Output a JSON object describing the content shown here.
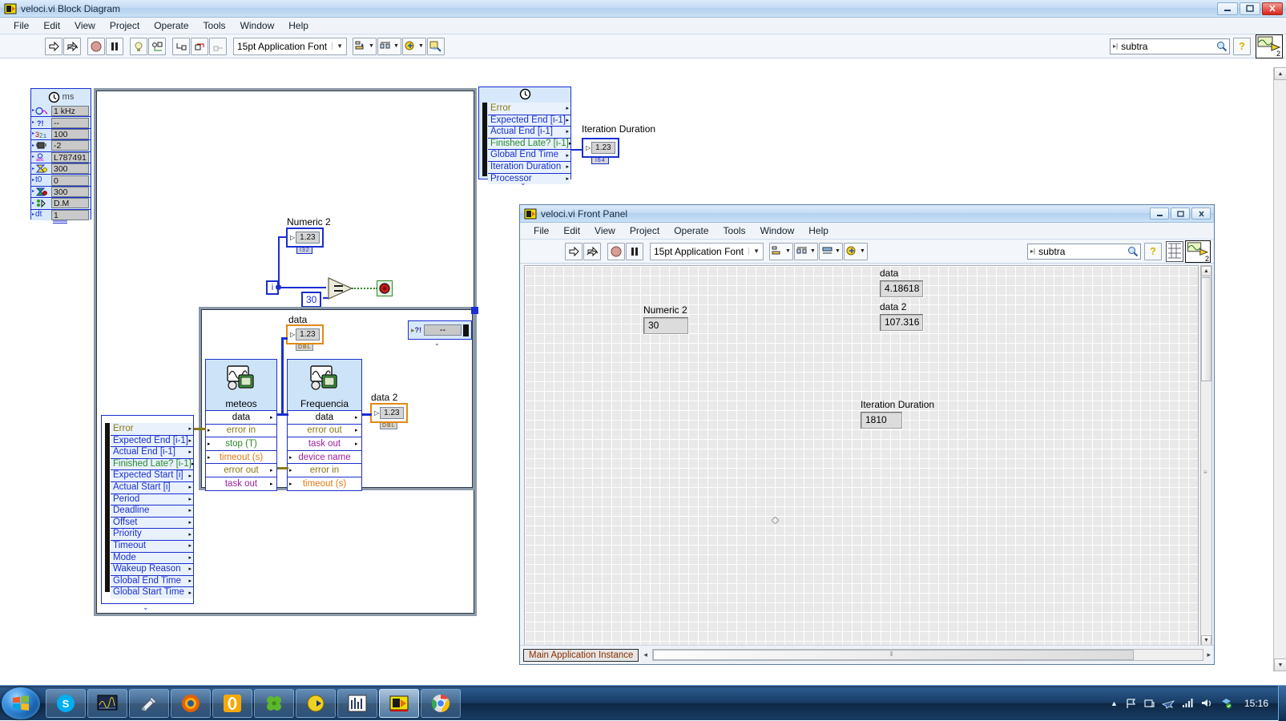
{
  "block_diagram": {
    "window_title": "veloci.vi Block Diagram",
    "app_icon": "labview-vi-icon",
    "window_buttons": [
      {
        "name": "minimize-button",
        "glyph": "—"
      },
      {
        "name": "maximize-button",
        "glyph": "❐"
      },
      {
        "name": "close-button",
        "glyph": "✕"
      }
    ],
    "menu": [
      "File",
      "Edit",
      "View",
      "Project",
      "Operate",
      "Tools",
      "Window",
      "Help"
    ],
    "toolbar": {
      "run_label": "run-arrow-icon",
      "run_continuous_label": "run-continuous-icon",
      "abort_label": "abort-execution-icon",
      "pause_label": "pause-icon",
      "highlight_label": "highlight-execution-icon",
      "step_into_label": "step-into-icon",
      "step_over_label": "step-over-icon",
      "step_out_label": "step-out-icon",
      "font": "15pt Application Font",
      "align_label": "align-objects-icon",
      "distribute_label": "distribute-objects-icon",
      "reorder_label": "reorder-icon",
      "cleanup_label": "clean-up-diagram-icon"
    },
    "search": {
      "value": "subtra",
      "placeholder": "",
      "icon": "search-magnifier-icon"
    },
    "help_button": "context-help-icon",
    "palette_badge": "2",
    "timing_node_left": {
      "title_units": "ms",
      "rows": [
        {
          "icon": "source-clock-icon",
          "value": "1 kHz"
        },
        {
          "icon": "error-in-icon",
          "value": "--"
        },
        {
          "icon": "priority-icon",
          "value": "100"
        },
        {
          "icon": "processor-icon",
          "value": "-2"
        },
        {
          "icon": "name-string-icon",
          "value": "L787491"
        },
        {
          "icon": "period-icon",
          "value": "300"
        },
        {
          "icon": "t0-icon",
          "value": "0",
          "label": "t0"
        },
        {
          "icon": "deadline-icon",
          "value": "300"
        },
        {
          "icon": "mode-icon",
          "value": "D.M"
        },
        {
          "icon": "dt-icon",
          "value": "1",
          "label": "dt"
        }
      ]
    },
    "timing_node_right": {
      "title_icon": "clock-icon",
      "rows": [
        "Error",
        "Expected End [i-1]",
        "Actual End [i-1]",
        "Finished Late? [i-1]",
        "Global End Time",
        "Iteration Duration",
        "Processor"
      ]
    },
    "iteration_duration_label": "Iteration Duration",
    "iteration_duration_ind": {
      "value": "1.23",
      "type": "I64"
    },
    "numeric2_label": "Numeric 2",
    "numeric2_ctrl": {
      "value": "1.23",
      "type": "I32"
    },
    "iteration_terminal": "i",
    "constant_30": "30",
    "compare_op": "=",
    "stop_button": "stop-sign-icon",
    "data_label": "data",
    "data_ind": {
      "value": "1.23",
      "type": "DBL"
    },
    "data2_label": "data 2",
    "data2_ind": {
      "value": "1.23",
      "type": "DBL"
    },
    "inner_timing_node": {
      "icon": "error-in-icon",
      "value": "--"
    },
    "subvi_meteos": {
      "name": "meteos",
      "icon": "waveform-daq-icon",
      "terminals": [
        "data",
        "error in",
        "stop (T)",
        "timeout (s)",
        "error out",
        "task out"
      ]
    },
    "subvi_frequencia": {
      "name": "Frequencia",
      "icon": "waveform-daq-icon",
      "terminals": [
        "data",
        "error out",
        "task out",
        "device name",
        "error in",
        "timeout (s)"
      ]
    },
    "cluster_bottom": {
      "rows": [
        "Error",
        "Expected End [i-1]",
        "Actual End [i-1]",
        "Finished Late? [i-1]",
        "Expected Start [i]",
        "Actual Start [i]",
        "Period",
        "Deadline",
        "Offset",
        "Priority",
        "Timeout",
        "Mode",
        "Wakeup Reason",
        "Global End Time",
        "Global Start Time"
      ]
    }
  },
  "front_panel": {
    "window_title": "veloci.vi Front Panel",
    "app_icon": "labview-vi-icon",
    "window_buttons": [
      {
        "name": "minimize-button",
        "glyph": "—"
      },
      {
        "name": "maximize-button",
        "glyph": "❐"
      },
      {
        "name": "close-button",
        "glyph": "✕"
      }
    ],
    "menu": [
      "File",
      "Edit",
      "View",
      "Project",
      "Operate",
      "Tools",
      "Window",
      "Help"
    ],
    "toolbar": {
      "run_label": "run-arrow-icon",
      "run_continuous_label": "run-continuous-icon",
      "abort_label": "abort-execution-icon",
      "pause_label": "pause-icon",
      "font": "15pt Application Font",
      "align_label": "align-objects-icon",
      "distribute_label": "distribute-objects-icon",
      "resize_label": "resize-objects-icon",
      "reorder_label": "reorder-icon"
    },
    "search": {
      "value": "subtra",
      "placeholder": "",
      "icon": "search-magnifier-icon"
    },
    "help_button": "context-help-icon",
    "palette_badge": "2",
    "controls": [
      {
        "name": "numeric2",
        "label": "Numeric 2",
        "value": "30"
      },
      {
        "name": "data",
        "label": "data",
        "value": "4.18618"
      },
      {
        "name": "data2",
        "label": "data 2",
        "value": "107.316"
      },
      {
        "name": "iteration-duration",
        "label": "Iteration Duration",
        "value": "1810"
      }
    ],
    "status_context": "Main Application Instance"
  },
  "taskbar": {
    "start_button": "windows-start-orb",
    "items": [
      {
        "name": "taskbar-item-skype",
        "icon": "skype-icon"
      },
      {
        "name": "taskbar-item-labview-project",
        "icon": "labview-icon"
      },
      {
        "name": "taskbar-item-winrar",
        "icon": "file-tool-icon"
      },
      {
        "name": "taskbar-item-firefox",
        "icon": "firefox-icon"
      },
      {
        "name": "taskbar-item-opera",
        "icon": "opera-icon"
      },
      {
        "name": "taskbar-item-clover",
        "icon": "clover-icon"
      },
      {
        "name": "taskbar-item-labview-vi",
        "icon": "labview-vi-icon"
      },
      {
        "name": "taskbar-item-measurement",
        "icon": "measurement-icon"
      },
      {
        "name": "taskbar-item-veloci-vi",
        "icon": "labview-vi-icon"
      },
      {
        "name": "taskbar-item-chrome",
        "icon": "chrome-icon"
      }
    ],
    "tray": [
      {
        "name": "tray-expand-icon",
        "glyph": "▲"
      },
      {
        "name": "tray-flag-action-center-icon",
        "glyph": "⚑"
      },
      {
        "name": "tray-device-icon",
        "glyph": "🖧"
      },
      {
        "name": "tray-network-plane-icon",
        "glyph": "✈"
      },
      {
        "name": "tray-signal-icon",
        "glyph": "▂▄▆"
      },
      {
        "name": "tray-volume-icon",
        "glyph": "🔊"
      },
      {
        "name": "tray-dropbox-icon",
        "glyph": "◈"
      }
    ],
    "clock": "15:16"
  },
  "colors": {
    "wire_blue": "#1a2fd0",
    "cluster_bg": "#e8f1fc",
    "cluster_header": "#d7e8fb",
    "indicator_orange": "#e08a14",
    "error_text": "#8a7a14",
    "bool_green": "#2e8b24",
    "subvi_header": "#cde3f8"
  }
}
